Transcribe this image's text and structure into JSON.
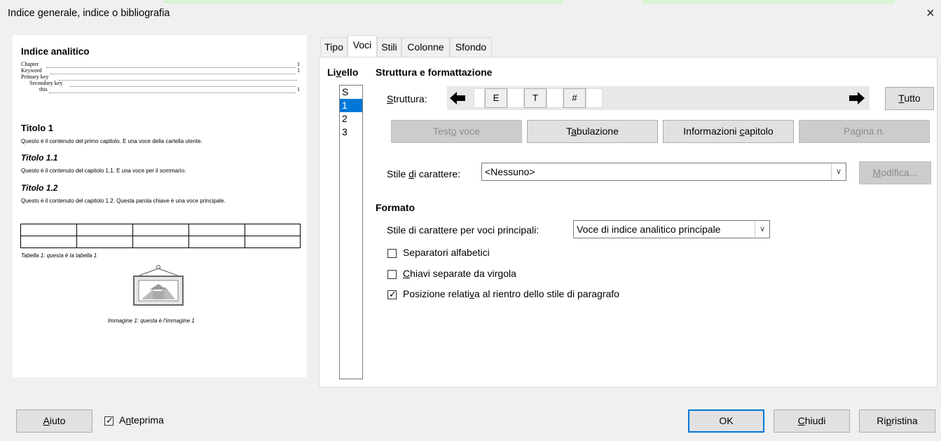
{
  "dialog": {
    "title": "Indice generale, indice o bibliografia",
    "close": "×"
  },
  "preview": {
    "index_title": "Indice analitico",
    "entries": [
      {
        "text": "Chapter",
        "page": "1"
      },
      {
        "text": "Keyword",
        "page": "1"
      },
      {
        "text": "Primary key",
        "page": ""
      },
      {
        "text": "Secondary key",
        "page": ""
      },
      {
        "text": "this",
        "page": "1"
      }
    ],
    "heading1": "Titolo 1",
    "para1": "Questo è il contenuto del primo capitolo. E una voce della cartella utente.",
    "heading11": "Titolo 1.1",
    "para11": "Questo è il contenuto del capitolo 1.1. E una voce per il sommario.",
    "heading12": "Titolo 1.2",
    "para12": "Questo è il contenuto del capitolo 1.2. Questa parola chiave è una voce principale.",
    "table_caption": "Tabella 1: questa è la tabella 1",
    "image_caption": "Immagine 1: questa è l'immagine 1"
  },
  "tabs": [
    "Tipo",
    "Voci",
    "Stili",
    "Colonne",
    "Sfondo"
  ],
  "active_tab": "Voci",
  "levels": {
    "label": "Livello",
    "items": [
      "S",
      "1",
      "2",
      "3"
    ],
    "selected": "1"
  },
  "structure_section": {
    "heading": "Struttura e formattazione",
    "structure_label": "Struttura:",
    "tokens": [
      "E",
      "T",
      "#"
    ],
    "all_button": "Tutto",
    "buttons": {
      "entry_text": "Testo voce",
      "tab_stop": "Tabulazione",
      "chapter_info": "Informazioni capitolo",
      "page_no": "Pagina n."
    },
    "char_style_label": "Stile di carattere:",
    "char_style_value": "<Nessuno>",
    "edit_button": "Modifica..."
  },
  "format_section": {
    "heading": "Formato",
    "main_entries_label": "Stile di carattere per voci principali:",
    "main_entries_value": "Voce di indice analitico principale",
    "alpha_delimiter": "Separatori alfabetici",
    "keys_separate": "Chiavi separate da virgola",
    "relative_tab": "Posizione relativa al rientro dello stile di paragrafo",
    "alpha_checked": false,
    "keys_checked": false,
    "relative_checked": true
  },
  "footer": {
    "help": "Aiuto",
    "preview": "Anteprima",
    "preview_checked": true,
    "ok": "OK",
    "close": "Chiudi",
    "reset": "Ripristina"
  }
}
